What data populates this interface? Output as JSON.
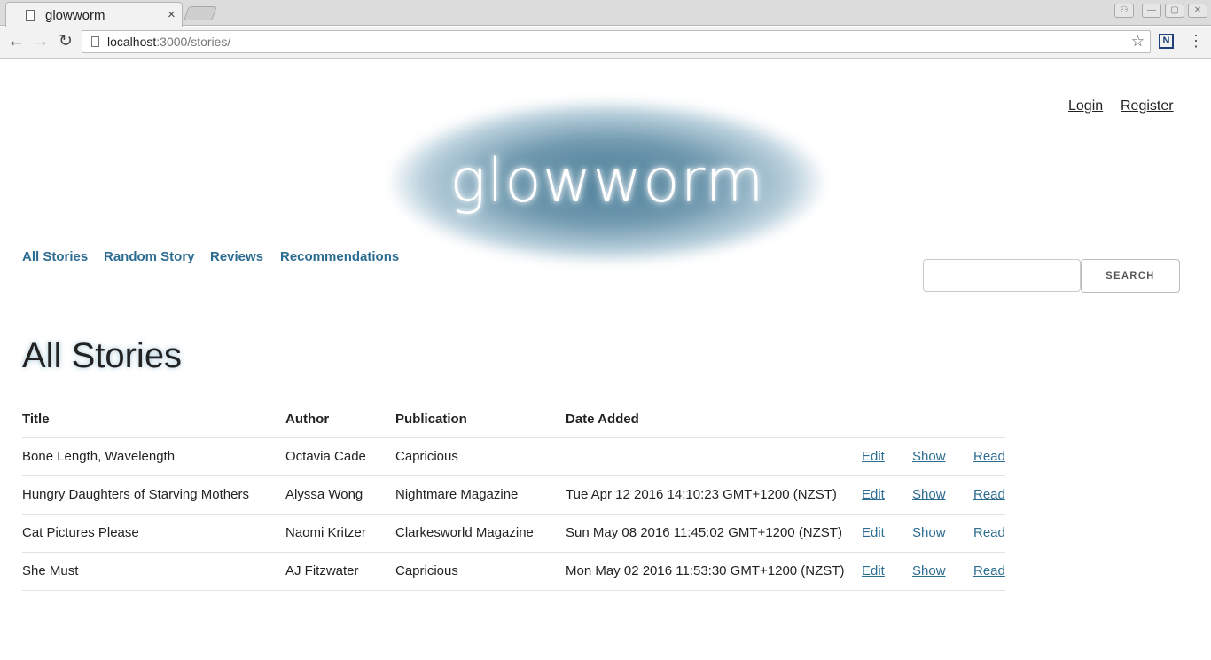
{
  "browser": {
    "tab_title": "glowworm",
    "tab_close": "×",
    "url_host": "localhost",
    "url_rest": ":3000/stories/",
    "back": "←",
    "forward": "→",
    "reload": "↻",
    "star": "☆",
    "ext_label": "N",
    "menu": "⋮",
    "win_user": "⚇",
    "win_min": "—",
    "win_max": "▢",
    "win_close": "✕"
  },
  "header": {
    "logo": "glowworm",
    "login": "Login",
    "register": "Register"
  },
  "nav": {
    "all_stories": "All Stories",
    "random_story": "Random Story",
    "reviews": "Reviews",
    "recommendations": "Recommendations"
  },
  "search": {
    "placeholder": "",
    "button": "SEARCH"
  },
  "main": {
    "title": "All Stories",
    "columns": [
      "Title",
      "Author",
      "Publication",
      "Date Added"
    ],
    "rows": [
      {
        "title": "Bone Length, Wavelength",
        "author": "Octavia Cade",
        "publication": "Capricious",
        "date": "",
        "edit": "Edit",
        "show": "Show",
        "read": "Read"
      },
      {
        "title": "Hungry Daughters of Starving Mothers",
        "author": "Alyssa Wong",
        "publication": "Nightmare Magazine",
        "date": "Tue Apr 12 2016 14:10:23 GMT+1200 (NZST)",
        "edit": "Edit",
        "show": "Show",
        "read": "Read"
      },
      {
        "title": "Cat Pictures Please",
        "author": "Naomi Kritzer",
        "publication": "Clarkesworld Magazine",
        "date": "Sun May 08 2016 11:45:02 GMT+1200 (NZST)",
        "edit": "Edit",
        "show": "Show",
        "read": "Read"
      },
      {
        "title": "She Must",
        "author": "AJ Fitzwater",
        "publication": "Capricious",
        "date": "Mon May 02 2016 11:53:30 GMT+1200 (NZST)",
        "edit": "Edit",
        "show": "Show",
        "read": "Read"
      }
    ]
  },
  "colors": {
    "link": "#2e6d92",
    "glow": "#4d7f99"
  }
}
